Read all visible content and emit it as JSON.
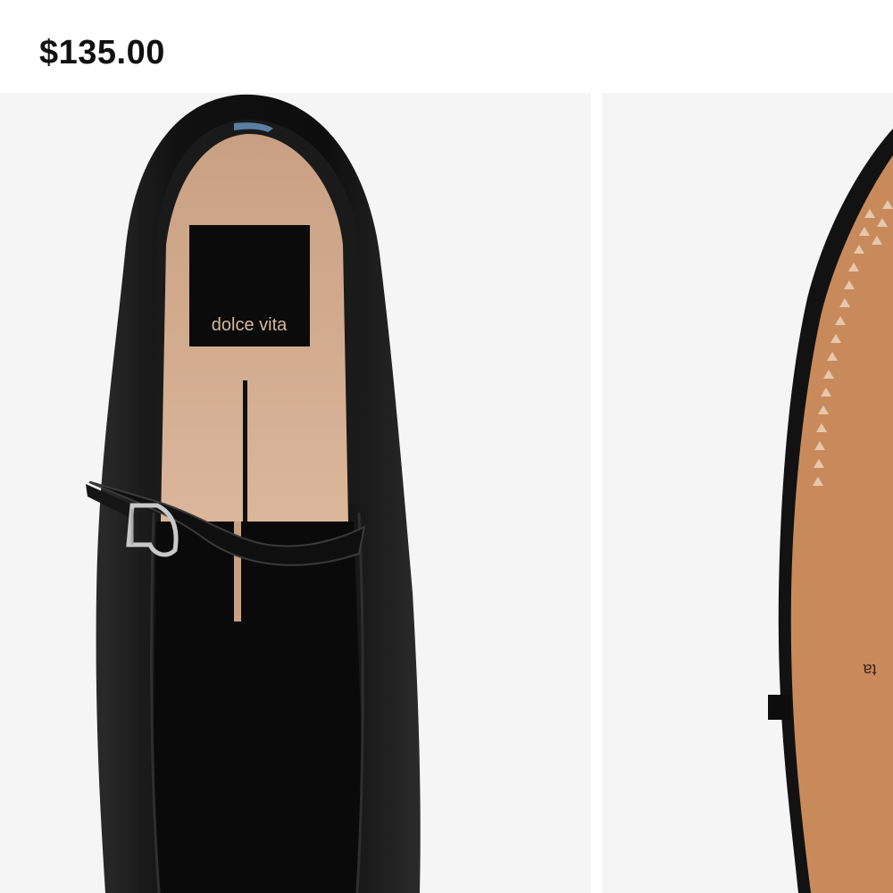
{
  "product": {
    "price": "$135.00"
  },
  "gallery": {
    "slides": [
      {
        "alt": "Black leather mary jane flat, top view",
        "insole_brand": "dolce vita"
      },
      {
        "alt": "Black leather mary jane flat, sole view",
        "sole_text": "ta"
      }
    ]
  },
  "colors": {
    "leather": "#141414",
    "insole": "#d2a98a",
    "sole": "#c98a5b",
    "background": "#f5f5f5"
  }
}
